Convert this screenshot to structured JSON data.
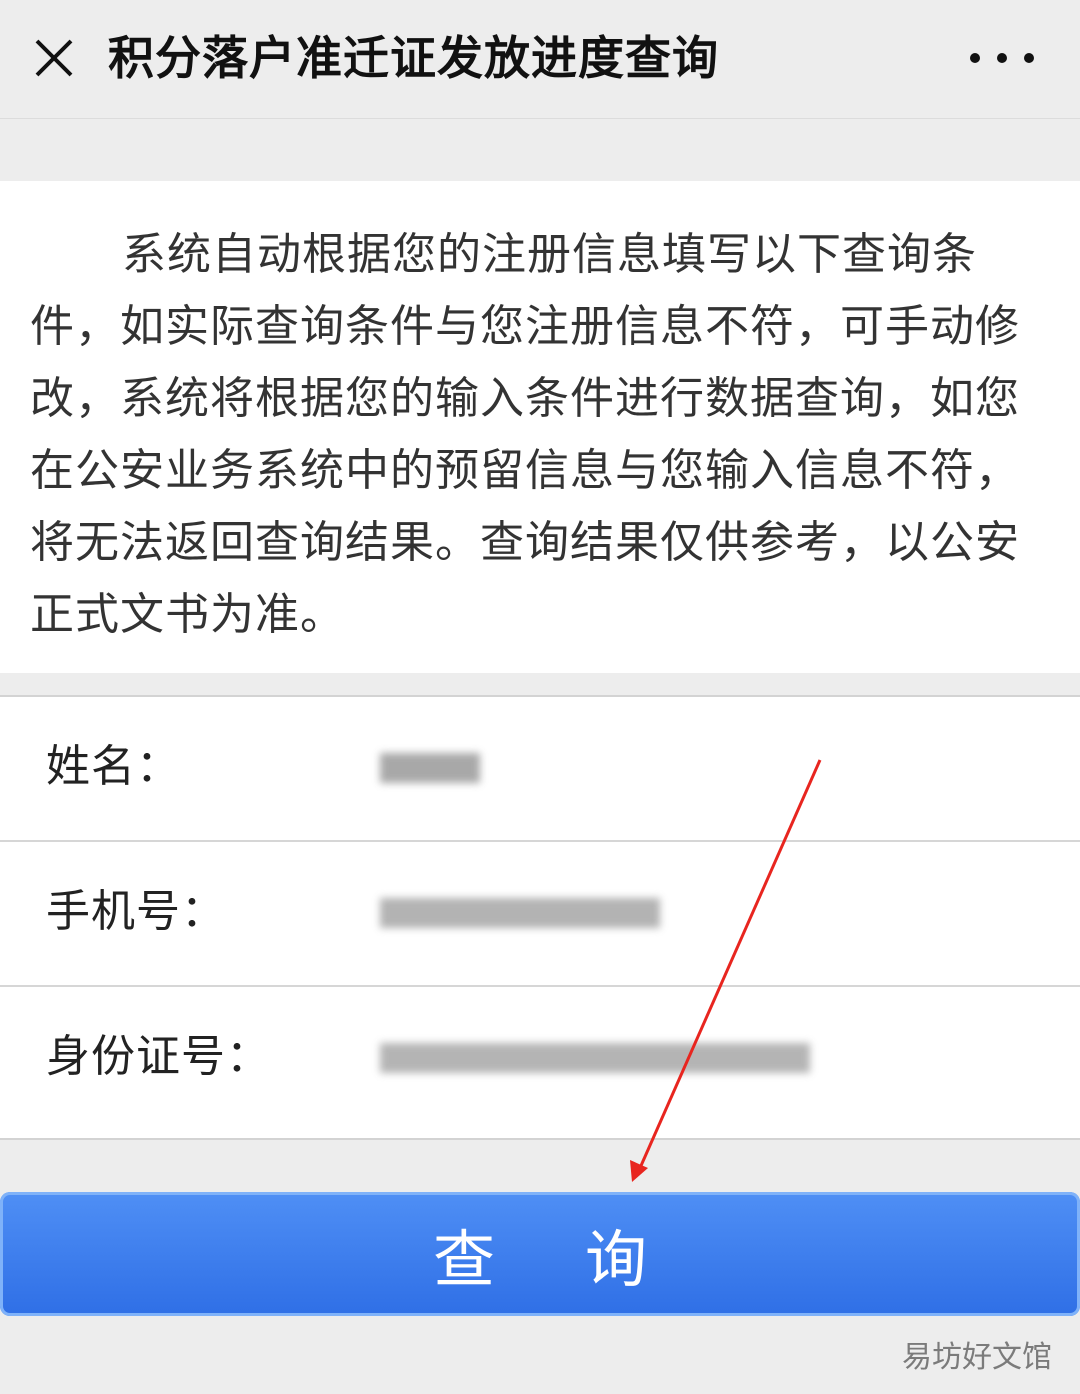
{
  "header": {
    "title": "积分落户准迁证发放进度查询",
    "close_icon": "close-icon",
    "more_icon": "more-icon"
  },
  "notice": {
    "text": "系统自动根据您的注册信息填写以下查询条件，如实际查询条件与您注册信息不符，可手动修改，系统将根据您的输入条件进行数据查询，如您在公安业务系统中的预留信息与您输入信息不符，将无法返回查询结果。查询结果仅供参考，以公安正式文书为准。"
  },
  "form": {
    "fields": [
      {
        "label": "姓名：",
        "value": ""
      },
      {
        "label": "手机号：",
        "value": ""
      },
      {
        "label": "身份证号：",
        "value": ""
      }
    ]
  },
  "submit": {
    "label": "查询"
  },
  "watermark": "易坊好文馆",
  "colors": {
    "accent": "#2f6fe6",
    "annotation_arrow": "#e8251f",
    "background": "#ededed"
  }
}
